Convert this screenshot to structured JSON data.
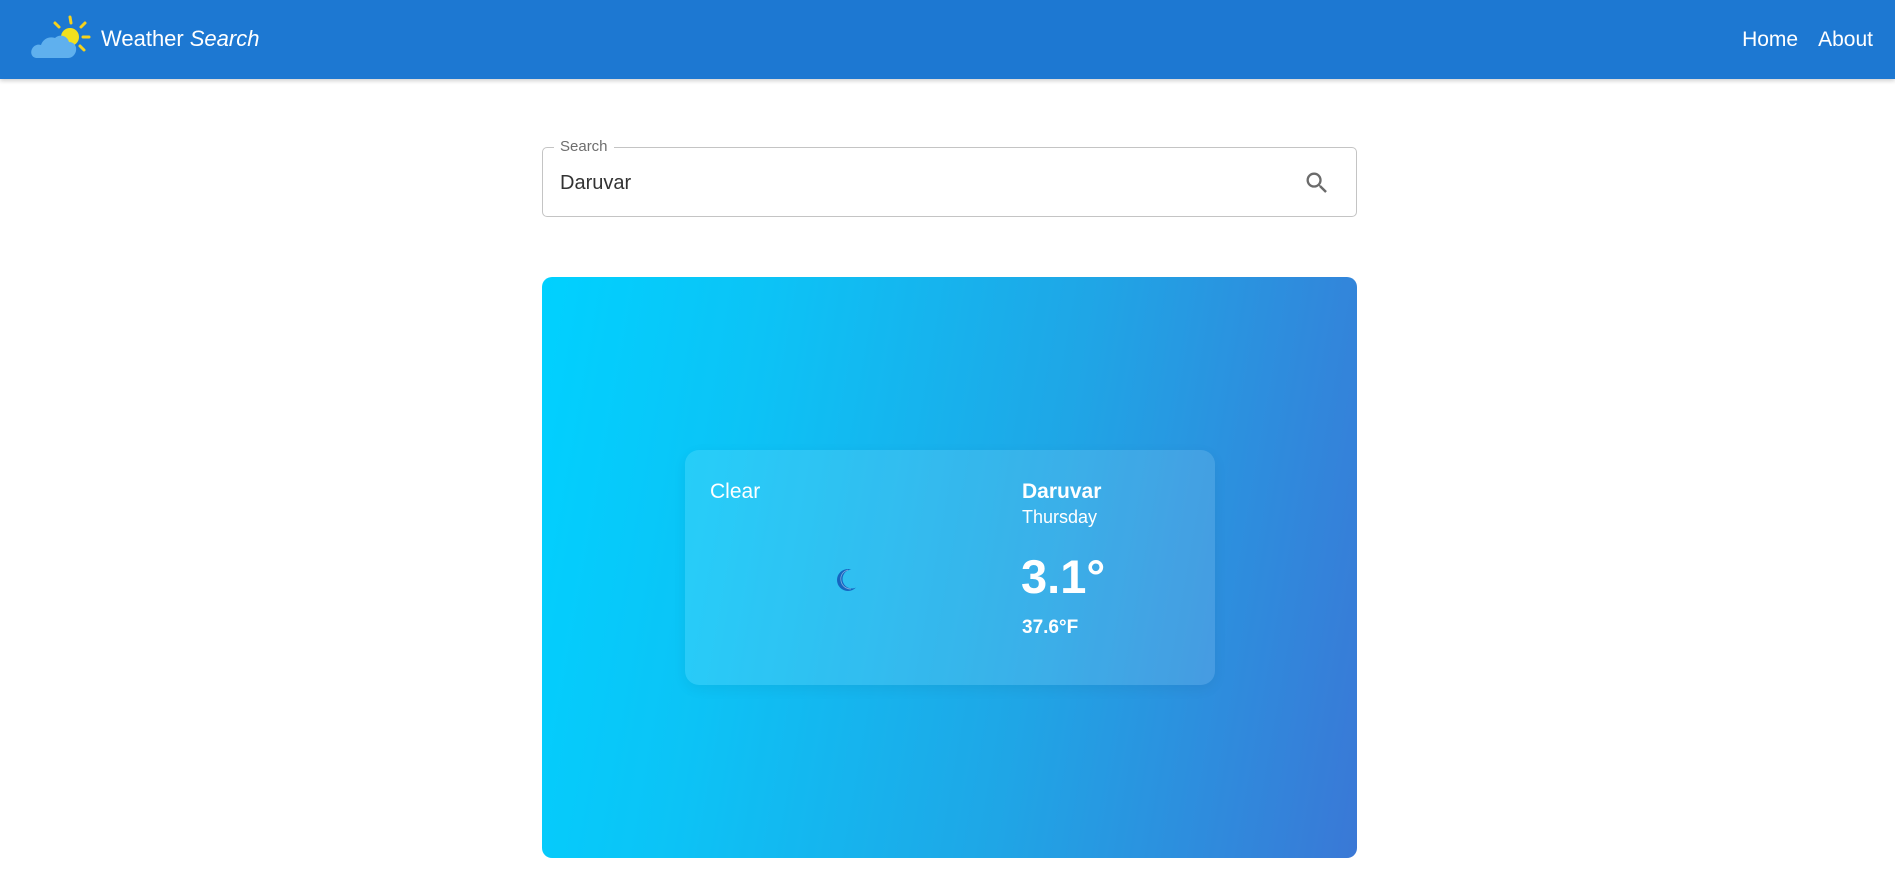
{
  "app": {
    "title_first": "Weather",
    "title_second": "Search",
    "logo_icon": "cloud-sun-icon"
  },
  "nav": {
    "home": "Home",
    "about": "About"
  },
  "search": {
    "label": "Search",
    "value": "Daruvar",
    "icon": "search-icon"
  },
  "weather": {
    "condition": "Clear",
    "condition_icon": "moon-icon",
    "city": "Daruvar",
    "day": "Thursday",
    "temp_c": "3.1°",
    "temp_f": "37.6°F"
  },
  "colors": {
    "appbar": "#1d78d2",
    "panel_gradient_start": "#00d1ff",
    "panel_gradient_end": "#3a78d6",
    "text_on_blue": "#ffffff",
    "moon": "#1565c0"
  }
}
